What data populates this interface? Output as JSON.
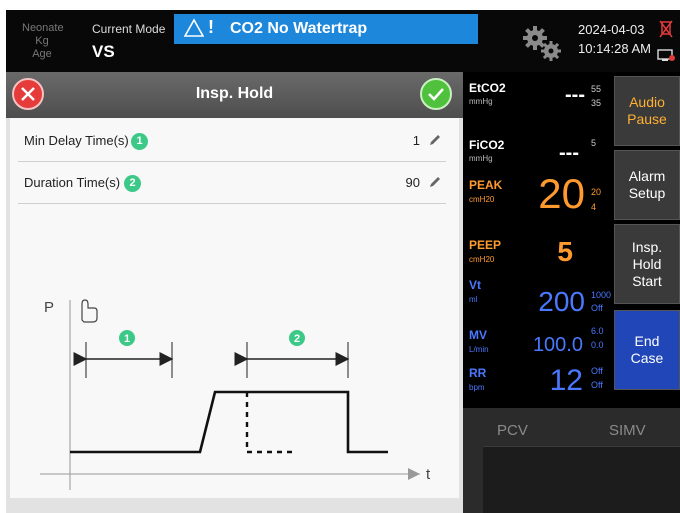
{
  "patient": {
    "type": "Neonate",
    "weight_unit": "Kg",
    "age_label": "Age"
  },
  "mode": {
    "label": "Current Mode",
    "value": "VS"
  },
  "alarm": {
    "icon": "warning-triangle-icon",
    "mark": "!",
    "text": "CO2 No Watertrap",
    "color": "#1d87dc"
  },
  "header": {
    "date": "2024-04-03",
    "time": "10:14:28 AM"
  },
  "insp_hold": {
    "title": "Insp. Hold",
    "rows": [
      {
        "badge": "1",
        "label": "Min Delay Time(s)",
        "value": "1"
      },
      {
        "badge": "2",
        "label": "Duration Time(s)",
        "value": "90"
      }
    ],
    "diagram": {
      "p_label": "P",
      "t_label": "t",
      "badge1": "1",
      "badge2": "2"
    }
  },
  "params": {
    "etco2": {
      "name": "EtCO2",
      "unit": "mmHg",
      "value": "---",
      "high": "55",
      "low": "35"
    },
    "fico2": {
      "name": "FiCO2",
      "unit": "mmHg",
      "value": "---",
      "high": "5"
    },
    "peak": {
      "name": "PEAK",
      "unit": "cmH20",
      "value": "20",
      "high": "20",
      "low": "4",
      "color": "#ff9a2e"
    },
    "peep": {
      "name": "PEEP",
      "unit": "cmH20",
      "value": "5",
      "color": "#ff9a2e"
    },
    "vt": {
      "name": "Vt",
      "unit": "ml",
      "value": "200",
      "high": "1000",
      "low": "Off",
      "color": "#4a78ff"
    },
    "mv": {
      "name": "MV",
      "unit": "L/min",
      "value": "100.0",
      "high": "6.0",
      "low": "0.0",
      "color": "#4a78ff"
    },
    "rr": {
      "name": "RR",
      "unit": "bpm",
      "value": "12",
      "high": "Off",
      "low": "Off",
      "color": "#4a78ff"
    }
  },
  "buttons": {
    "audio_pause": [
      "Audio",
      "Pause"
    ],
    "alarm_setup": [
      "Alarm",
      "Setup"
    ],
    "insp_hold_start": [
      "Insp.",
      "Hold",
      "Start"
    ],
    "end_case": [
      "End",
      "Case"
    ]
  },
  "modes": {
    "pcv": "PCV",
    "simv": "SIMV"
  }
}
